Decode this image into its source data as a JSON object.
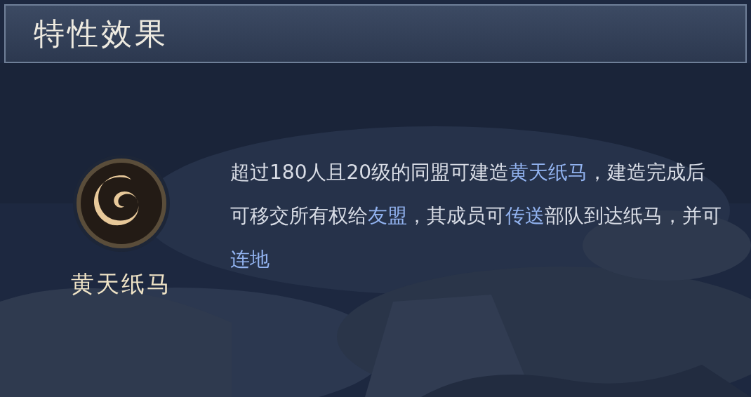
{
  "header": {
    "title": "特性效果"
  },
  "building": {
    "name": "黄天纸马"
  },
  "description": [
    {
      "text": "超过180人且20级的同盟可建造",
      "highlight": false
    },
    {
      "text": "黄天纸马",
      "highlight": true
    },
    {
      "text": "，建造完成后可移交所有权给",
      "highlight": false
    },
    {
      "text": "友盟",
      "highlight": true
    },
    {
      "text": "，其成员可",
      "highlight": false
    },
    {
      "text": "传送",
      "highlight": true
    },
    {
      "text": "部队到达纸马，并可",
      "highlight": false
    },
    {
      "text": "连地",
      "highlight": true
    }
  ]
}
